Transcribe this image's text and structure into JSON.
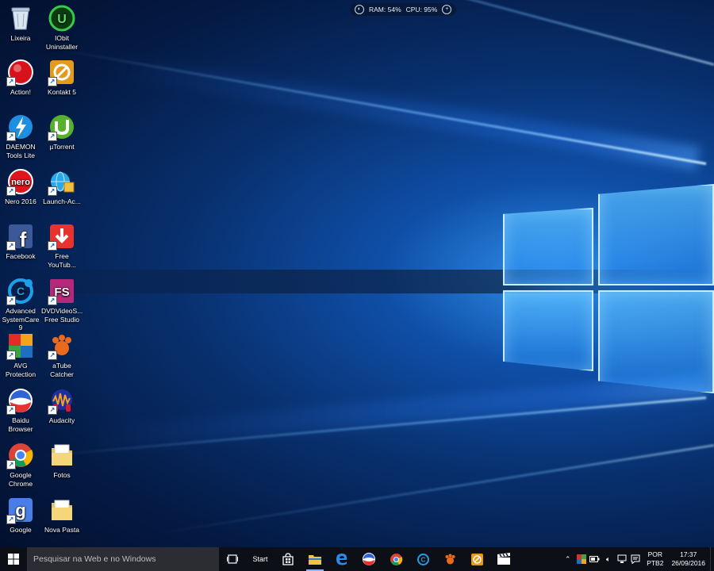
{
  "desktop": {
    "icons": [
      {
        "label": "Lixeira",
        "icon": "recycle-bin-icon"
      },
      {
        "label": "IObit Uninstaller",
        "icon": "iobit-uninstaller-icon"
      },
      {
        "label": "Action!",
        "icon": "action-record-icon"
      },
      {
        "label": "Kontakt 5",
        "icon": "kontakt-icon"
      },
      {
        "label": "DAEMON Tools Lite",
        "icon": "daemon-tools-icon"
      },
      {
        "label": "µTorrent",
        "icon": "utorrent-icon"
      },
      {
        "label": "Nero 2016",
        "icon": "nero-icon"
      },
      {
        "label": "Launch-Ac...",
        "icon": "launch-globe-icon"
      },
      {
        "label": "Facebook",
        "icon": "facebook-icon"
      },
      {
        "label": "Free YouTub...",
        "icon": "download-arrow-icon"
      },
      {
        "label": "Advanced SystemCare 9",
        "icon": "systemcare-icon"
      },
      {
        "label": "DVDVideoS... Free Studio",
        "icon": "fs-studio-icon"
      },
      {
        "label": "AVG Protection",
        "icon": "avg-icon"
      },
      {
        "label": "aTube Catcher",
        "icon": "atube-catcher-icon"
      },
      {
        "label": "Baidu Browser",
        "icon": "baidu-browser-icon"
      },
      {
        "label": "Audacity",
        "icon": "audacity-icon"
      },
      {
        "label": "Google Chrome",
        "icon": "chrome-icon"
      },
      {
        "label": "Fotos",
        "icon": "folder-icon"
      },
      {
        "label": "Google",
        "icon": "google-icon"
      },
      {
        "label": "Nova Pasta",
        "icon": "folder-icon"
      }
    ]
  },
  "monitor": {
    "ram": "RAM: 54%",
    "cpu": "CPU: 95%"
  },
  "taskbar": {
    "search_placeholder": "Pesquisar na Web e no Windows",
    "start_label": "Start",
    "apps": [
      {
        "name": "store",
        "icon": "store-icon"
      },
      {
        "name": "explorer",
        "icon": "file-explorer-icon"
      },
      {
        "name": "edge",
        "icon": "edge-icon"
      },
      {
        "name": "baidu",
        "icon": "baidu-browser-icon"
      },
      {
        "name": "chrome",
        "icon": "chrome-icon"
      },
      {
        "name": "systemcare",
        "icon": "systemcare-icon"
      },
      {
        "name": "atube",
        "icon": "atube-catcher-icon"
      },
      {
        "name": "kontakt",
        "icon": "kontakt-icon"
      },
      {
        "name": "movie",
        "icon": "clapperboard-icon"
      }
    ],
    "tray": {
      "lang_line1": "POR",
      "lang_line2": "PTB2",
      "time": "17:37",
      "date": "26/09/2016"
    }
  },
  "colors": {
    "taskbar": "#0c0f16",
    "search": "#2b2d33",
    "accent": "#1e8cf0"
  }
}
